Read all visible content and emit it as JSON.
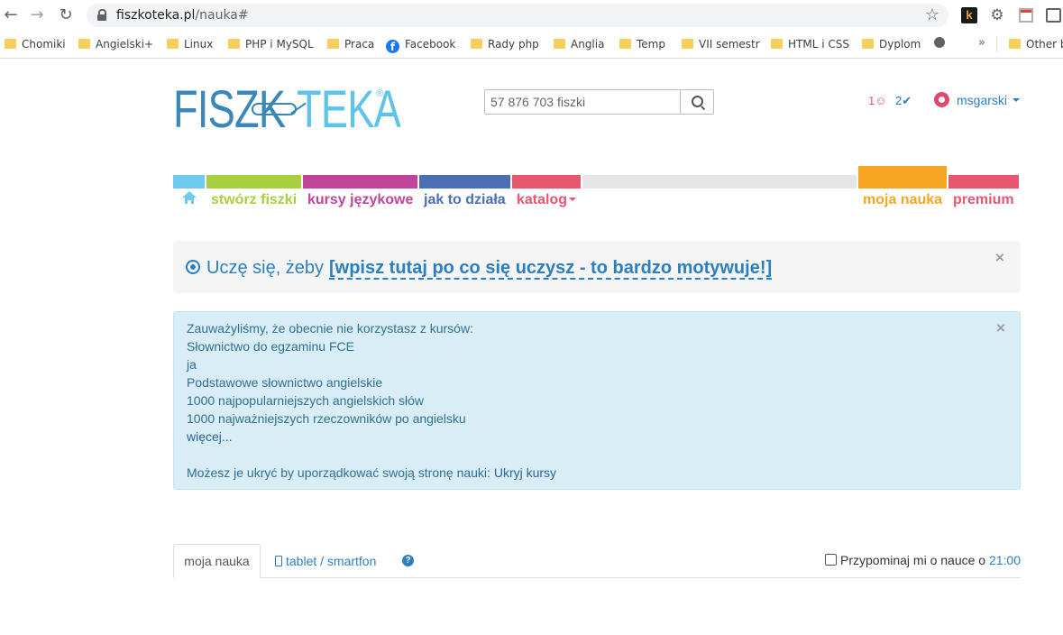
{
  "browser": {
    "url_host": "fiszkoteka.pl",
    "url_path": "/nauka#",
    "bookmarks": [
      "Chomiki",
      "Angielski+",
      "Linux",
      "PHP i MySQL",
      "Praca",
      "Facebook",
      "Rady php",
      "Anglia",
      "Temp",
      "VII semestr",
      "HTML i CSS",
      "Dyplom"
    ],
    "other_bookmarks": "Other b",
    "more_chevron": "»",
    "ext_k": "k"
  },
  "header": {
    "logo_left": "FISZK",
    "logo_right": "TEKA",
    "logo_reg": "®",
    "search_placeholder": "57 876 703 fiszki",
    "notif_a": "1☺",
    "notif_b": "2✔",
    "username": "msgarski"
  },
  "nav": {
    "create": "stwórz fiszki",
    "courses": "kursy językowe",
    "how": "jak to działa",
    "catalog": "katalog",
    "my_learning": "moja nauka",
    "premium": "premium"
  },
  "colors": {
    "blue_light": "#6ccbee",
    "green": "#a8cf3d",
    "magenta": "#c0449a",
    "navy": "#4a6fb5",
    "pink": "#e8566f",
    "gray": "#e6e6e6",
    "orange": "#f6a623"
  },
  "motivation": {
    "prefix": "Uczę się, żeby",
    "link": "[wpisz tutaj po co się uczysz - to bardzo motywuje!]",
    "close": "×"
  },
  "alert": {
    "line1": "Zauważyliśmy, że obecnie nie korzystasz z kursów:",
    "courses": [
      "Słownictwo do egzaminu FCE",
      "ja",
      "Podstawowe słownictwo angielskie",
      "1000 najpopularniejszych angielskich słów",
      "1000 najważniejszych rzeczowników po angielsku"
    ],
    "more": "więcej...",
    "hide_text": "Możesz je ukryć by uporządkować swoją stronę nauki:",
    "hide_link": "Ukryj kursy",
    "close": "×"
  },
  "tabs": {
    "active": "moja nauka",
    "tablet": "tablet / smartfon",
    "help": "?"
  },
  "reminder": {
    "label": "Przypominaj mi o nauce o",
    "time": "21:00"
  }
}
